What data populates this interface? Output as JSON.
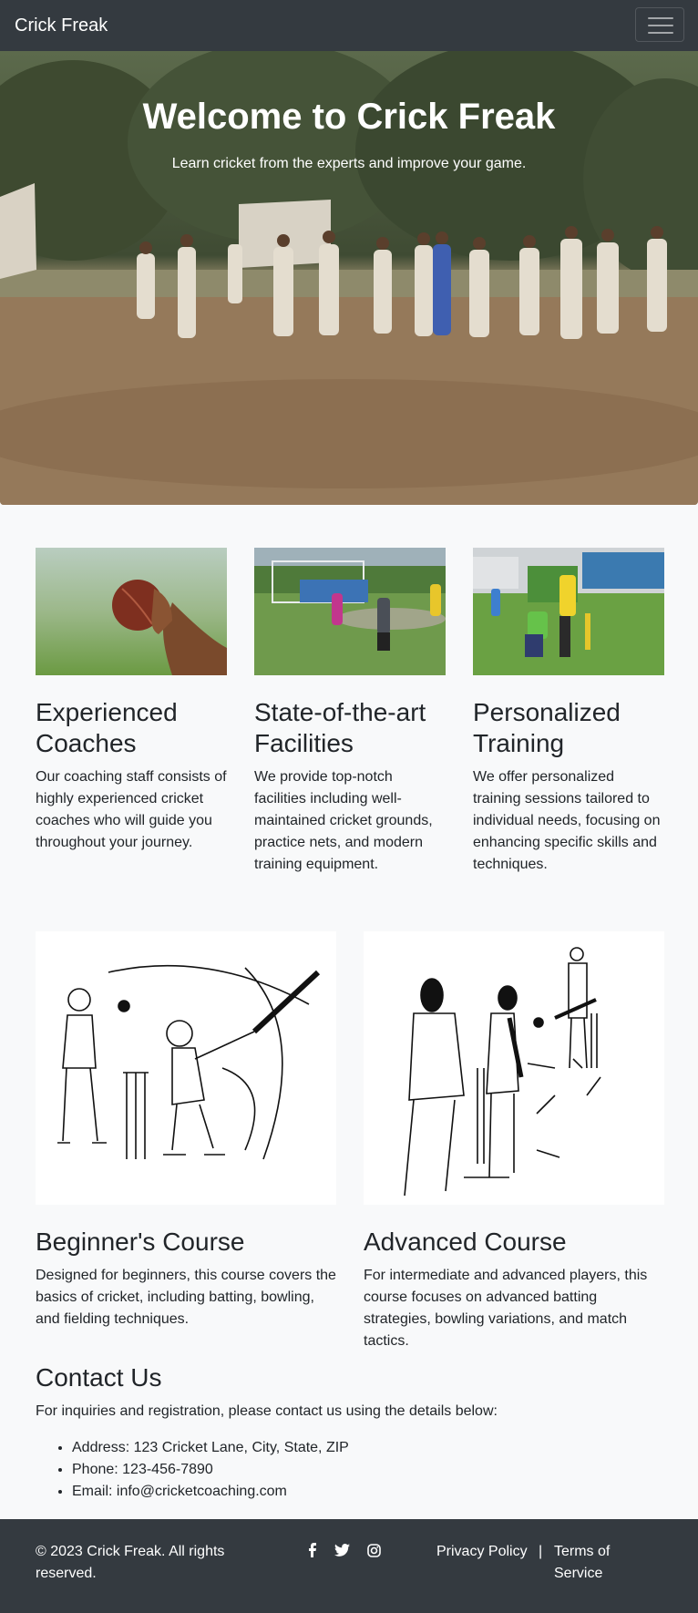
{
  "navbar": {
    "brand": "Crick Freak",
    "toggle_icon": "hamburger-icon"
  },
  "hero": {
    "title": "Welcome to Crick Freak",
    "subtitle": "Learn cricket from the experts and improve your game."
  },
  "features": [
    {
      "title": "Experienced Coaches",
      "text": "Our coaching staff consists of highly experienced cricket coaches who will guide you throughout your journey."
    },
    {
      "title": "State-of-the-art Facilities",
      "text": "We provide top-notch facilities including well-maintained cricket grounds, practice nets, and modern training equipment."
    },
    {
      "title": "Personalized Training",
      "text": "We offer personalized training sessions tailored to individual needs, focusing on enhancing specific skills and techniques."
    }
  ],
  "courses": [
    {
      "title": "Beginner's Course",
      "text": "Designed for beginners, this course covers the basics of cricket, including batting, bowling, and fielding techniques."
    },
    {
      "title": "Advanced Course",
      "text": "For intermediate and advanced players, this course focuses on advanced batting strategies, bowling variations, and match tactics."
    }
  ],
  "contact": {
    "title": "Contact Us",
    "intro": "For inquiries and registration, please contact us using the details below:",
    "items": [
      "Address: 123 Cricket Lane, City, State, ZIP",
      "Phone: 123-456-7890",
      "Email: info@cricketcoaching.com"
    ]
  },
  "footer": {
    "copyright": "© 2023 Crick Freak. All rights reserved.",
    "social_icons": [
      "facebook-icon",
      "twitter-icon",
      "instagram-icon"
    ],
    "privacy": "Privacy Policy",
    "separator": "|",
    "terms": "Terms of Service"
  }
}
